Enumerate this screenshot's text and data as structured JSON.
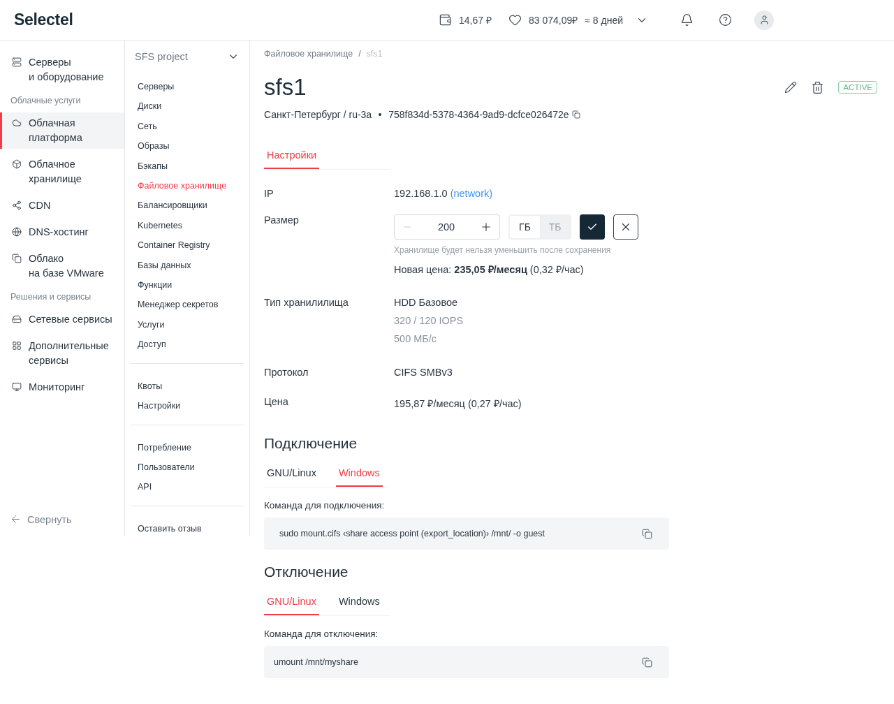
{
  "header": {
    "logo": "Selectel",
    "balance": "14,67 ₽",
    "bonus": "83 074,09₽",
    "forecast": "≈ 8 дней"
  },
  "nav": {
    "items": [
      {
        "kind": "item",
        "text": "Серверы\nи оборудование",
        "selected": false
      },
      {
        "kind": "section",
        "text": "Облачные услуги"
      },
      {
        "kind": "item",
        "text": "Облачная\nплатформа",
        "selected": true
      },
      {
        "kind": "item",
        "text": "Облачное\nхранилище",
        "selected": false
      },
      {
        "kind": "item",
        "text": "CDN",
        "selected": false
      },
      {
        "kind": "item",
        "text": "DNS-хостинг",
        "selected": false
      },
      {
        "kind": "item",
        "text": "Облако\nна базе VMware",
        "selected": false
      },
      {
        "kind": "section",
        "text": "Решения и сервисы"
      },
      {
        "kind": "item",
        "text": "Сетевые сервисы",
        "selected": false
      },
      {
        "kind": "item",
        "text": "Дополнительные\nсервисы",
        "selected": false
      },
      {
        "kind": "item",
        "text": "Мониторинг",
        "selected": false
      }
    ],
    "collapse": "Свернуть"
  },
  "project": {
    "name": "SFS project",
    "groups": [
      [
        {
          "label": "Серверы",
          "selected": false
        },
        {
          "label": "Диски",
          "selected": false
        },
        {
          "label": "Сеть",
          "selected": false
        },
        {
          "label": "Образы",
          "selected": false
        },
        {
          "label": "Бэкапы",
          "selected": false
        },
        {
          "label": "Файловое хранилище",
          "selected": true
        },
        {
          "label": "Балансировщики",
          "selected": false
        },
        {
          "label": "Kubernetes",
          "selected": false
        },
        {
          "label": "Container Registry",
          "selected": false
        },
        {
          "label": "Базы данных",
          "selected": false
        },
        {
          "label": "Функции",
          "selected": false
        },
        {
          "label": "Менеджер секретов",
          "selected": false
        },
        {
          "label": "Услуги",
          "selected": false
        },
        {
          "label": "Доступ",
          "selected": false
        }
      ],
      [
        {
          "label": "Квоты",
          "selected": false
        },
        {
          "label": "Настройки",
          "selected": false
        }
      ],
      [
        {
          "label": "Потребление",
          "selected": false
        },
        {
          "label": "Пользователи",
          "selected": false
        },
        {
          "label": "API",
          "selected": false
        }
      ],
      [
        {
          "label": "Оставить отзыв",
          "selected": false
        }
      ]
    ]
  },
  "breadcrumb": [
    "Файловое хранилище",
    "sfs1"
  ],
  "breadcrumb_separator": "/",
  "title": "sfs1",
  "location": "Санкт-Петербург / ru-3a",
  "uuid": "758f834d-5378-4364-9ad9-dcfce026472e",
  "status": "ACTIVE",
  "tabs": [
    {
      "label": "Настройки",
      "selected": true
    }
  ],
  "fields": [
    {
      "kind": "ip",
      "label": "IP",
      "value": "192.168.1.0",
      "link": "(network)"
    },
    {
      "kind": "size",
      "label": "Размер",
      "value": "200",
      "units": [
        {
          "label": "ГБ",
          "selected": true
        },
        {
          "label": "ТБ",
          "selected": false
        }
      ],
      "hint": "Хранилище будет нельзя уменьшить после сохранения",
      "price": "Новая цена: **235,05 ₽/месяц** (0,32 ₽/час)"
    },
    {
      "kind": "lines",
      "label": "Тип хранилилища",
      "lines": [
        "HDD Базовое",
        "320 / 120 IOPS",
        "500 МБ/с"
      ]
    },
    {
      "kind": "lines",
      "label": "Протокол",
      "lines": [
        "CIFS SMBv3"
      ]
    },
    {
      "kind": "lines",
      "label": "Цена",
      "lines": [
        "195,87 ₽/месяц (0,27 ₽/час)"
      ]
    }
  ],
  "sections": [
    {
      "title": "Подключение",
      "tabs": [
        {
          "label": "GNU/Linux",
          "selected": false
        },
        {
          "label": "Windows",
          "selected": true
        }
      ],
      "command_label": "Команда для подключения:",
      "command": "sudo mount.cifs ‹share access point (export_location)› /mnt/ -o guest"
    },
    {
      "title": "Отключение",
      "tabs": [
        {
          "label": "GNU/Linux",
          "selected": true
        },
        {
          "label": "Windows",
          "selected": false
        }
      ],
      "command_label": "Команда для отключения:",
      "command": "umount /mnt/myshare"
    }
  ]
}
